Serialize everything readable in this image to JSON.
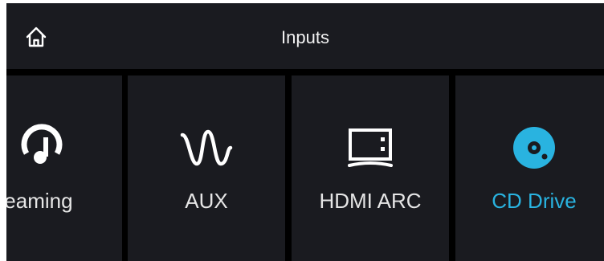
{
  "header": {
    "title": "Inputs",
    "home_icon": "home-icon"
  },
  "colors": {
    "background": "#000000",
    "panel": "#1a1b20",
    "text": "#e6e6e6",
    "accent": "#29b3e0"
  },
  "inputs": [
    {
      "label": "treaming",
      "icon": "streaming-music-icon",
      "selected": false
    },
    {
      "label": "AUX",
      "icon": "aux-wave-icon",
      "selected": false
    },
    {
      "label": "HDMI ARC",
      "icon": "tv-icon",
      "selected": false
    },
    {
      "label": "CD Drive",
      "icon": "cd-disc-icon",
      "selected": true
    }
  ]
}
